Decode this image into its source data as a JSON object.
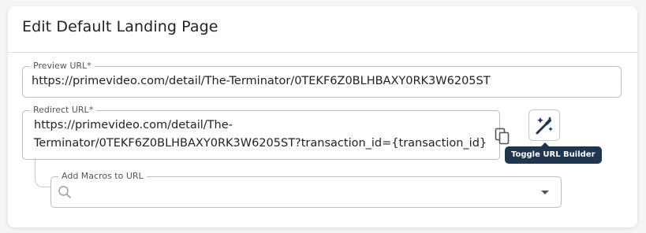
{
  "dialog": {
    "title": "Edit Default Landing Page"
  },
  "preview": {
    "label": "Preview URL",
    "required_mark": "*",
    "value": "https://primevideo.com/detail/The-Terminator/0TEKF6Z0BLHBAXY0RK3W6205ST"
  },
  "redirect": {
    "label": "Redirect URL",
    "required_mark": "*",
    "value_line1": "https://primevideo.com/detail/The-",
    "value_line2": "Terminator/0TEKF6Z0BLHBAXY0RK3W6205ST?transaction_id={transaction_id}",
    "copy_icon": "copy-icon"
  },
  "url_builder": {
    "icon": "magic-wand-icon",
    "tooltip": "Toggle URL Builder"
  },
  "macros": {
    "label": "Add Macros to URL",
    "search_icon": "search-icon",
    "dropdown_icon": "caret-down-icon",
    "value": ""
  },
  "colors": {
    "tooltip_bg": "#1f3550",
    "border": "#bdbdbd",
    "text": "#222222"
  }
}
